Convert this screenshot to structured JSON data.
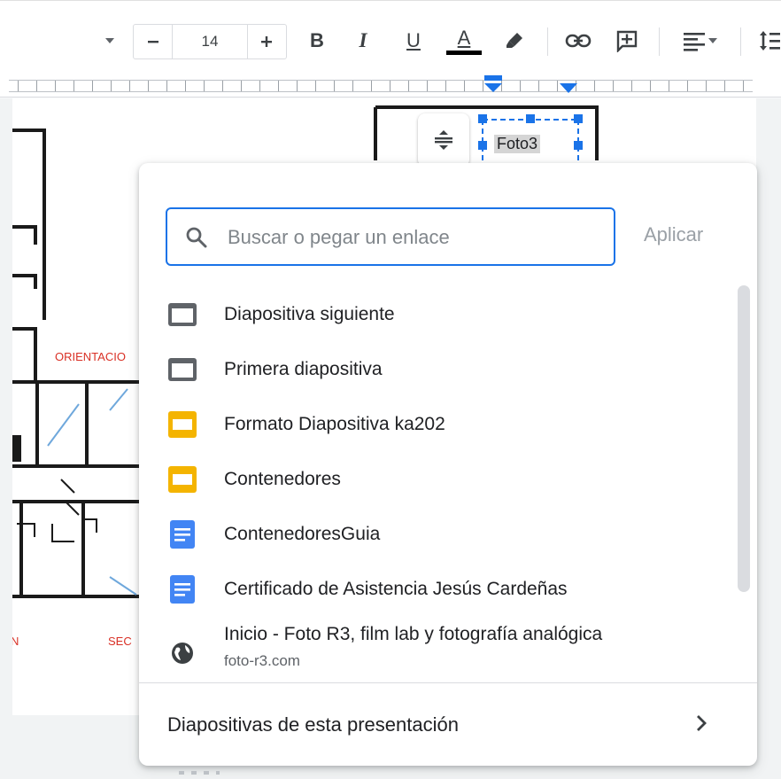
{
  "toolbar": {
    "font_size": "14",
    "bold_label": "B",
    "italic_label": "I",
    "underline_label": "U",
    "text_color_label": "A",
    "text_color": "#000000"
  },
  "slide": {
    "text_box_label": "Foto3",
    "plan_labels": {
      "orientation": "ORIENTACIO",
      "left_bottom": "N",
      "sec": "SEC"
    }
  },
  "link_popup": {
    "search_placeholder": "Buscar o pegar un enlace",
    "search_value": "",
    "apply_label": "Aplicar",
    "items": [
      {
        "icon": "slide-icon",
        "label": "Diapositiva siguiente"
      },
      {
        "icon": "slide-icon",
        "label": "Primera diapositiva"
      },
      {
        "icon": "slides-file-icon",
        "label": "Formato Diapositiva ka202"
      },
      {
        "icon": "slides-file-icon",
        "label": "Contenedores"
      },
      {
        "icon": "docs-file-icon",
        "label": "ContenedoresGuia"
      },
      {
        "icon": "docs-file-icon",
        "label": "Certificado de Asistencia Jesús Cardeñas"
      },
      {
        "icon": "globe-icon",
        "label": "Inicio - Foto R3, film lab y fotografía analógica",
        "sublabel": "foto-r3.com"
      }
    ],
    "footer_label": "Diapositivas de esta presentación"
  },
  "colors": {
    "accent": "#1a73e8",
    "slides_yellow": "#f4b400",
    "docs_blue": "#4285f4",
    "plan_red": "#d93025"
  }
}
